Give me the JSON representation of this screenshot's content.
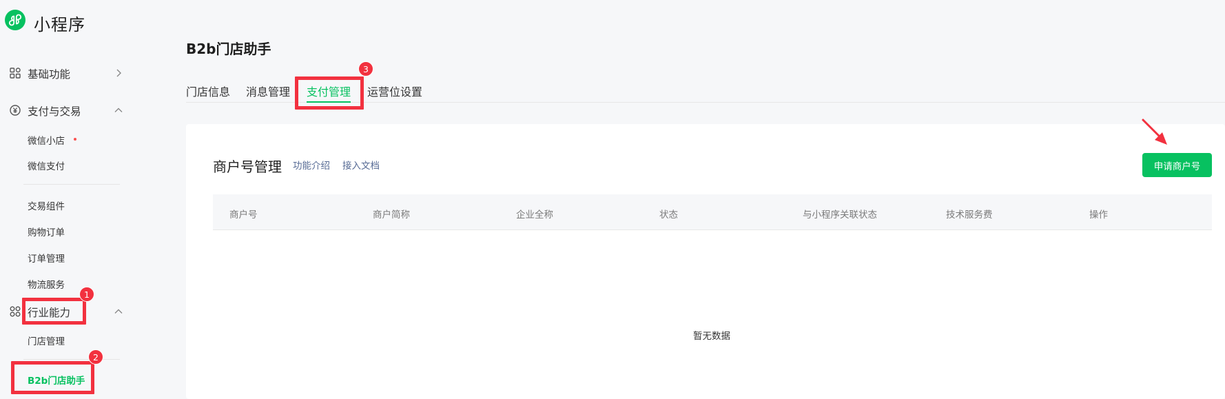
{
  "app": {
    "logo_text": "小程序"
  },
  "sidebar": {
    "sections": [
      {
        "label": "基础功能",
        "icon": "grid-icon",
        "expanded": false
      },
      {
        "label": "支付与交易",
        "icon": "yen-circle-icon",
        "expanded": true
      },
      {
        "label": "行业能力",
        "icon": "industry-icon",
        "expanded": true
      }
    ],
    "items": {
      "weixin_shop": "微信小店",
      "weixin_pay": "微信支付",
      "trade_component": "交易组件",
      "shopping_order": "购物订单",
      "order_manage": "订单管理",
      "logistics": "物流服务",
      "store_manage": "门店管理",
      "b2b_assistant": "B2b门店助手"
    }
  },
  "main": {
    "title": "B2b门店助手",
    "tabs": [
      {
        "label": "门店信息",
        "active": false
      },
      {
        "label": "消息管理",
        "active": false
      },
      {
        "label": "支付管理",
        "active": true
      },
      {
        "label": "运营位设置",
        "active": false
      }
    ],
    "card": {
      "title": "商户号管理",
      "links": [
        "功能介绍",
        "接入文档"
      ],
      "apply_button": "申请商户号",
      "columns": [
        "商户号",
        "商户简称",
        "企业全称",
        "状态",
        "与小程序关联状态",
        "技术服务费",
        "操作"
      ],
      "empty_text": "暂无数据"
    }
  },
  "annotations": {
    "badges": [
      "1",
      "2",
      "3"
    ]
  },
  "colors": {
    "accent": "#07c160",
    "link": "#576b95",
    "annotation": "#f2313f",
    "dot": "#fa5151"
  }
}
